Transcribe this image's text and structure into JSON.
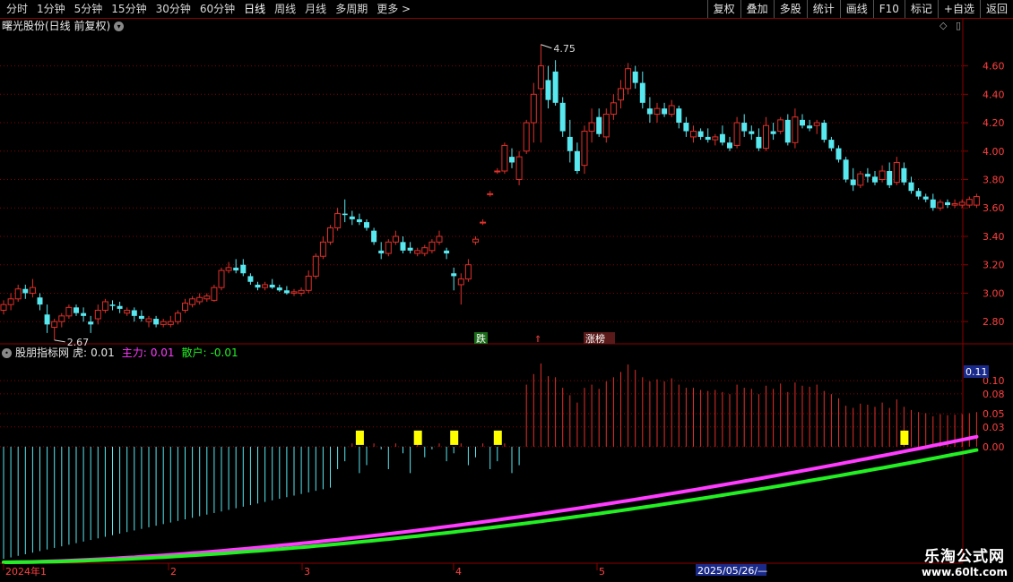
{
  "toolbar": {
    "periods": [
      "分时",
      "1分钟",
      "5分钟",
      "15分钟",
      "30分钟",
      "60分钟",
      "日线",
      "周线",
      "月线",
      "多周期",
      "更多 >"
    ],
    "active_period": "日线",
    "right_buttons": [
      "复权",
      "叠加",
      "多股",
      "统计",
      "画线",
      "F10",
      "标记",
      "+自选",
      "返回"
    ]
  },
  "main_chart": {
    "title": "曙光股份(日线 前复权)",
    "y_ticks": [
      "4.60",
      "4.40",
      "4.20",
      "4.00",
      "3.80",
      "3.60",
      "3.40",
      "3.20",
      "3.00",
      "2.80"
    ],
    "high_label": "4.75",
    "low_label": "2.67",
    "markers": [
      "跌",
      "涨榜"
    ]
  },
  "indicator": {
    "name": "股朋指标网",
    "tiger_label": "虎:",
    "tiger_value": "0.01",
    "main_label": "主力:",
    "main_value": "0.01",
    "retail_label": "散户:",
    "retail_value": "-0.01",
    "current_value": "0.11",
    "y_ticks": [
      "0.10",
      "0.08",
      "0.05",
      "0.03",
      "0.00"
    ]
  },
  "x_axis": {
    "labels": [
      "2024年1",
      "2",
      "3",
      "4",
      "5"
    ],
    "cursor_date": "2025/05/26/—"
  },
  "watermark": {
    "line1": "乐淘公式网",
    "line2": "www.60lt.com"
  },
  "colors": {
    "up": "#e0302a",
    "down": "#58e8f0",
    "grid": "#8b0000",
    "main_line": "#ff3cff",
    "retail_line": "#22f022",
    "flag": "#ffff00"
  },
  "chart_data": {
    "type": "candlestick",
    "ylim": [
      2.65,
      4.78
    ],
    "candles": [
      [
        2.88,
        2.95,
        2.85,
        2.92
      ],
      [
        2.92,
        3.0,
        2.88,
        2.96
      ],
      [
        2.96,
        3.06,
        2.94,
        3.03
      ],
      [
        3.03,
        3.06,
        2.96,
        3.0
      ],
      [
        3.0,
        3.1,
        2.97,
        3.04
      ],
      [
        2.97,
        3.0,
        2.88,
        2.92
      ],
      [
        2.85,
        2.92,
        2.72,
        2.78
      ],
      [
        2.76,
        2.82,
        2.67,
        2.8
      ],
      [
        2.8,
        2.86,
        2.76,
        2.84
      ],
      [
        2.84,
        2.92,
        2.82,
        2.9
      ],
      [
        2.9,
        2.92,
        2.84,
        2.86
      ],
      [
        2.86,
        2.9,
        2.8,
        2.84
      ],
      [
        2.8,
        2.84,
        2.72,
        2.78
      ],
      [
        2.82,
        2.92,
        2.78,
        2.88
      ],
      [
        2.88,
        2.96,
        2.86,
        2.94
      ],
      [
        2.92,
        2.95,
        2.88,
        2.91
      ],
      [
        2.91,
        2.94,
        2.86,
        2.89
      ],
      [
        2.86,
        2.9,
        2.84,
        2.88
      ],
      [
        2.88,
        2.9,
        2.8,
        2.84
      ],
      [
        2.84,
        2.88,
        2.8,
        2.82
      ],
      [
        2.8,
        2.84,
        2.76,
        2.82
      ],
      [
        2.82,
        2.84,
        2.76,
        2.78
      ],
      [
        2.78,
        2.82,
        2.76,
        2.8
      ],
      [
        2.78,
        2.84,
        2.76,
        2.8
      ],
      [
        2.8,
        2.88,
        2.78,
        2.86
      ],
      [
        2.88,
        2.96,
        2.86,
        2.93
      ],
      [
        2.92,
        2.98,
        2.9,
        2.96
      ],
      [
        2.94,
        3.0,
        2.92,
        2.97
      ],
      [
        2.96,
        3.0,
        2.94,
        2.98
      ],
      [
        2.95,
        3.06,
        2.94,
        3.04
      ],
      [
        3.04,
        3.18,
        3.02,
        3.16
      ],
      [
        3.16,
        3.22,
        3.14,
        3.18
      ],
      [
        3.18,
        3.24,
        3.14,
        3.16
      ],
      [
        3.2,
        3.24,
        3.12,
        3.14
      ],
      [
        3.12,
        3.14,
        3.06,
        3.08
      ],
      [
        3.06,
        3.08,
        3.02,
        3.04
      ],
      [
        3.04,
        3.08,
        3.02,
        3.06
      ],
      [
        3.06,
        3.1,
        3.03,
        3.04
      ],
      [
        3.04,
        3.06,
        3.01,
        3.02
      ],
      [
        3.02,
        3.05,
        2.99,
        3.0
      ],
      [
        3.0,
        3.03,
        2.98,
        3.01
      ],
      [
        3.0,
        3.04,
        2.98,
        3.02
      ],
      [
        3.02,
        3.16,
        3.0,
        3.12
      ],
      [
        3.12,
        3.28,
        3.1,
        3.26
      ],
      [
        3.26,
        3.4,
        3.24,
        3.36
      ],
      [
        3.36,
        3.48,
        3.34,
        3.46
      ],
      [
        3.46,
        3.6,
        3.44,
        3.56
      ],
      [
        3.56,
        3.66,
        3.5,
        3.55
      ],
      [
        3.54,
        3.58,
        3.48,
        3.52
      ],
      [
        3.52,
        3.56,
        3.48,
        3.5
      ],
      [
        3.5,
        3.52,
        3.44,
        3.46
      ],
      [
        3.44,
        3.46,
        3.34,
        3.36
      ],
      [
        3.3,
        3.36,
        3.24,
        3.28
      ],
      [
        3.28,
        3.38,
        3.26,
        3.36
      ],
      [
        3.36,
        3.44,
        3.34,
        3.4
      ],
      [
        3.36,
        3.4,
        3.28,
        3.3
      ],
      [
        3.32,
        3.36,
        3.28,
        3.3
      ],
      [
        3.28,
        3.32,
        3.26,
        3.3
      ],
      [
        3.28,
        3.34,
        3.26,
        3.32
      ],
      [
        3.3,
        3.38,
        3.28,
        3.36
      ],
      [
        3.36,
        3.44,
        3.34,
        3.4
      ],
      [
        3.3,
        3.32,
        3.24,
        3.28
      ],
      [
        3.14,
        3.18,
        3.02,
        3.12
      ],
      [
        3.06,
        3.14,
        2.92,
        3.1
      ],
      [
        3.1,
        3.24,
        3.08,
        3.2
      ],
      [
        3.36,
        3.4,
        3.34,
        3.38
      ],
      [
        3.5,
        3.52,
        3.48,
        3.5
      ],
      [
        3.7,
        3.72,
        3.68,
        3.7
      ],
      [
        3.86,
        3.88,
        3.84,
        3.86
      ],
      [
        3.86,
        4.06,
        3.84,
        4.04
      ],
      [
        3.96,
        4.02,
        3.88,
        3.92
      ],
      [
        3.8,
        4.0,
        3.76,
        3.96
      ],
      [
        4.0,
        4.22,
        3.98,
        4.2
      ],
      [
        4.2,
        4.48,
        4.06,
        4.4
      ],
      [
        4.44,
        4.75,
        4.06,
        4.6
      ],
      [
        4.5,
        4.6,
        4.3,
        4.36
      ],
      [
        4.56,
        4.64,
        4.32,
        4.34
      ],
      [
        4.34,
        4.38,
        4.1,
        4.14
      ],
      [
        4.1,
        4.22,
        3.92,
        4.0
      ],
      [
        4.0,
        4.06,
        3.84,
        3.86
      ],
      [
        3.9,
        4.18,
        3.84,
        4.14
      ],
      [
        4.14,
        4.3,
        4.06,
        4.2
      ],
      [
        4.24,
        4.3,
        4.1,
        4.12
      ],
      [
        4.1,
        4.3,
        4.06,
        4.26
      ],
      [
        4.26,
        4.4,
        4.22,
        4.34
      ],
      [
        4.36,
        4.5,
        4.3,
        4.44
      ],
      [
        4.44,
        4.62,
        4.4,
        4.58
      ],
      [
        4.56,
        4.6,
        4.44,
        4.48
      ],
      [
        4.48,
        4.56,
        4.3,
        4.34
      ],
      [
        4.3,
        4.38,
        4.2,
        4.26
      ],
      [
        4.26,
        4.34,
        4.2,
        4.3
      ],
      [
        4.3,
        4.34,
        4.24,
        4.26
      ],
      [
        4.26,
        4.36,
        4.24,
        4.32
      ],
      [
        4.3,
        4.32,
        4.16,
        4.2
      ],
      [
        4.2,
        4.24,
        4.1,
        4.14
      ],
      [
        4.1,
        4.18,
        4.06,
        4.14
      ],
      [
        4.14,
        4.16,
        4.08,
        4.1
      ],
      [
        4.1,
        4.16,
        4.06,
        4.08
      ],
      [
        4.08,
        4.12,
        4.04,
        4.1
      ],
      [
        4.12,
        4.18,
        4.04,
        4.06
      ],
      [
        4.06,
        4.1,
        4.0,
        4.02
      ],
      [
        4.04,
        4.24,
        4.02,
        4.2
      ],
      [
        4.2,
        4.26,
        4.1,
        4.14
      ],
      [
        4.14,
        4.18,
        4.08,
        4.12
      ],
      [
        4.1,
        4.16,
        4.0,
        4.02
      ],
      [
        4.02,
        4.24,
        4.0,
        4.18
      ],
      [
        4.14,
        4.2,
        4.08,
        4.12
      ],
      [
        4.14,
        4.24,
        4.12,
        4.22
      ],
      [
        4.22,
        4.26,
        4.04,
        4.06
      ],
      [
        4.06,
        4.3,
        4.02,
        4.24
      ],
      [
        4.22,
        4.26,
        4.16,
        4.18
      ],
      [
        4.18,
        4.22,
        4.14,
        4.16
      ],
      [
        4.18,
        4.22,
        4.12,
        4.2
      ],
      [
        4.2,
        4.22,
        4.06,
        4.08
      ],
      [
        4.08,
        4.1,
        4.0,
        4.02
      ],
      [
        4.02,
        4.04,
        3.92,
        3.94
      ],
      [
        3.94,
        3.96,
        3.78,
        3.8
      ],
      [
        3.8,
        3.88,
        3.72,
        3.76
      ],
      [
        3.76,
        3.86,
        3.74,
        3.84
      ],
      [
        3.84,
        3.88,
        3.78,
        3.82
      ],
      [
        3.82,
        3.86,
        3.76,
        3.78
      ],
      [
        3.8,
        3.9,
        3.78,
        3.86
      ],
      [
        3.86,
        3.92,
        3.74,
        3.76
      ],
      [
        3.78,
        3.96,
        3.76,
        3.92
      ],
      [
        3.88,
        3.92,
        3.76,
        3.78
      ],
      [
        3.78,
        3.82,
        3.7,
        3.72
      ],
      [
        3.72,
        3.74,
        3.66,
        3.68
      ],
      [
        3.68,
        3.7,
        3.64,
        3.66
      ],
      [
        3.66,
        3.7,
        3.58,
        3.6
      ],
      [
        3.6,
        3.66,
        3.58,
        3.64
      ],
      [
        3.64,
        3.66,
        3.6,
        3.62
      ],
      [
        3.62,
        3.66,
        3.6,
        3.63
      ],
      [
        3.62,
        3.66,
        3.6,
        3.64
      ],
      [
        3.62,
        3.68,
        3.6,
        3.66
      ],
      [
        3.62,
        3.7,
        3.6,
        3.68
      ]
    ]
  }
}
